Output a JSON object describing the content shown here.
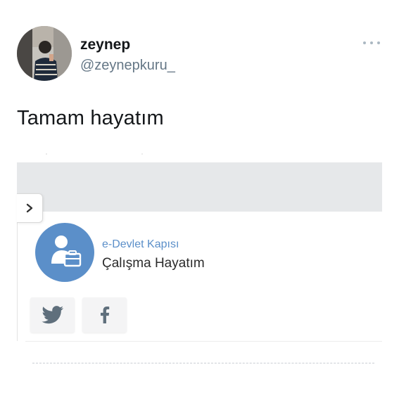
{
  "tweet": {
    "author_name": "zeynep",
    "author_handle": "@zeynepkuru_",
    "text": "Tamam hayatım",
    "more_icon": "more-dots-icon"
  },
  "card": {
    "expand_icon": "chevron-right-icon",
    "org_logo_icon": "person-briefcase-icon",
    "org_kicker": "e-Devlet Kapısı",
    "org_title": "Çalışma Hayatım",
    "share_buttons": [
      {
        "icon": "twitter-bird-icon"
      },
      {
        "icon": "facebook-f-icon"
      }
    ]
  },
  "colors": {
    "accent_blue": "#5b8fc9",
    "banner_gray": "#e6e8ea",
    "handle_gray": "#657786",
    "text_dark": "#14171a"
  }
}
